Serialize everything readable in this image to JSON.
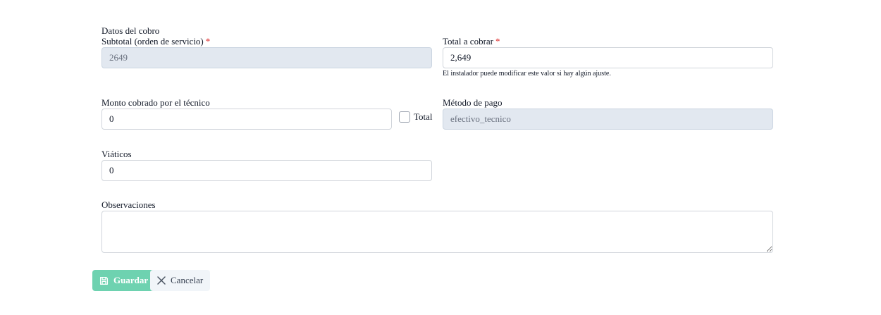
{
  "form": {
    "section_title": "Datos del cobro",
    "subtotal": {
      "label": "Subtotal (orden de servicio)",
      "required_mark": "*",
      "value": "2649"
    },
    "total": {
      "label": "Total a cobrar",
      "required_mark": "*",
      "value": "2,649",
      "hint": "El instalador puede modificar este valor si hay algún ajuste."
    },
    "monto": {
      "label": "Monto cobrado por el técnico",
      "value": "0",
      "checkbox_label": "Total",
      "checkbox_checked": false
    },
    "metodo": {
      "label": "Método de pago",
      "value": "efectivo_tecnico"
    },
    "viaticos": {
      "label": "Viáticos",
      "value": "0"
    },
    "observaciones": {
      "label": "Observaciones",
      "value": ""
    }
  },
  "actions": {
    "save_label": "Guardar",
    "cancel_label": "Cancelar"
  },
  "icons": {
    "save": "floppy-disk-icon",
    "cancel": "close-icon"
  },
  "colors": {
    "required": "#dc2626",
    "save_button": "#6ed2b0",
    "disabled_field": "#e2e8f0"
  }
}
